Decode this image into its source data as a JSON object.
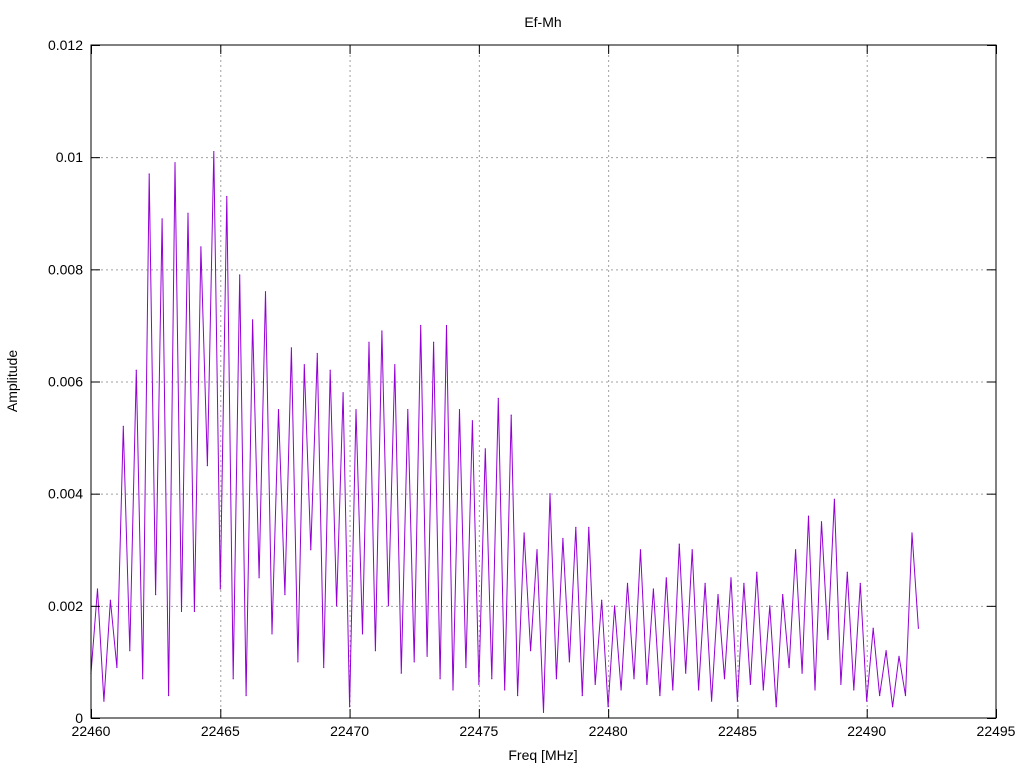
{
  "chart_data": {
    "type": "line",
    "title": "Ef-Mh",
    "xlabel": "Freq [MHz]",
    "ylabel": "Amplitude",
    "xlim": [
      22460,
      22495
    ],
    "ylim": [
      0,
      0.012
    ],
    "grid": true,
    "xticks": [
      22460,
      22465,
      22470,
      22475,
      22480,
      22485,
      22490,
      22495
    ],
    "xtick_labels": [
      "22460",
      "22465",
      "22470",
      "22475",
      "22480",
      "22485",
      "22490",
      "22495"
    ],
    "yticks": [
      0,
      0.002,
      0.004,
      0.006,
      0.008,
      0.01,
      0.012
    ],
    "ytick_labels": [
      "0",
      "0.002",
      "0.004",
      "0.006",
      "0.008",
      "0.01",
      "0.012"
    ],
    "series": [
      {
        "name": "Ef-Mh",
        "color": "#9400d3",
        "x_start": 22460,
        "x_step": 0.25,
        "values": [
          0.0008,
          0.0023,
          0.0003,
          0.0021,
          0.0009,
          0.0052,
          0.0012,
          0.0062,
          0.0007,
          0.0097,
          0.0022,
          0.0089,
          0.0004,
          0.0099,
          0.0019,
          0.009,
          0.0019,
          0.0084,
          0.0045,
          0.0101,
          0.0023,
          0.0093,
          0.0007,
          0.0079,
          0.0004,
          0.0071,
          0.0025,
          0.0076,
          0.0015,
          0.0055,
          0.0022,
          0.0066,
          0.001,
          0.0063,
          0.003,
          0.0065,
          0.0009,
          0.0062,
          0.002,
          0.0058,
          0.0002,
          0.0055,
          0.0015,
          0.0067,
          0.0012,
          0.0069,
          0.002,
          0.0063,
          0.0008,
          0.0055,
          0.001,
          0.007,
          0.0011,
          0.0067,
          0.0007,
          0.007,
          0.0005,
          0.0055,
          0.0009,
          0.0053,
          0.0006,
          0.0048,
          0.0007,
          0.0057,
          0.0005,
          0.0054,
          0.0004,
          0.0033,
          0.0012,
          0.003,
          0.0001,
          0.004,
          0.0007,
          0.0032,
          0.001,
          0.0034,
          0.0004,
          0.0034,
          0.0006,
          0.0021,
          0.0002,
          0.002,
          0.0005,
          0.0024,
          0.0007,
          0.003,
          0.0006,
          0.0023,
          0.0004,
          0.0025,
          0.0005,
          0.0031,
          0.0008,
          0.003,
          0.0005,
          0.0024,
          0.0003,
          0.0022,
          0.0007,
          0.0025,
          0.0003,
          0.0024,
          0.0006,
          0.0026,
          0.0005,
          0.002,
          0.0002,
          0.0022,
          0.0009,
          0.003,
          0.0008,
          0.0036,
          0.0005,
          0.0035,
          0.0014,
          0.0039,
          0.0006,
          0.0026,
          0.0005,
          0.0024,
          0.0003,
          0.0016,
          0.0004,
          0.0012,
          0.0002,
          0.0011,
          0.0004,
          0.0033,
          0.0016
        ]
      }
    ]
  }
}
